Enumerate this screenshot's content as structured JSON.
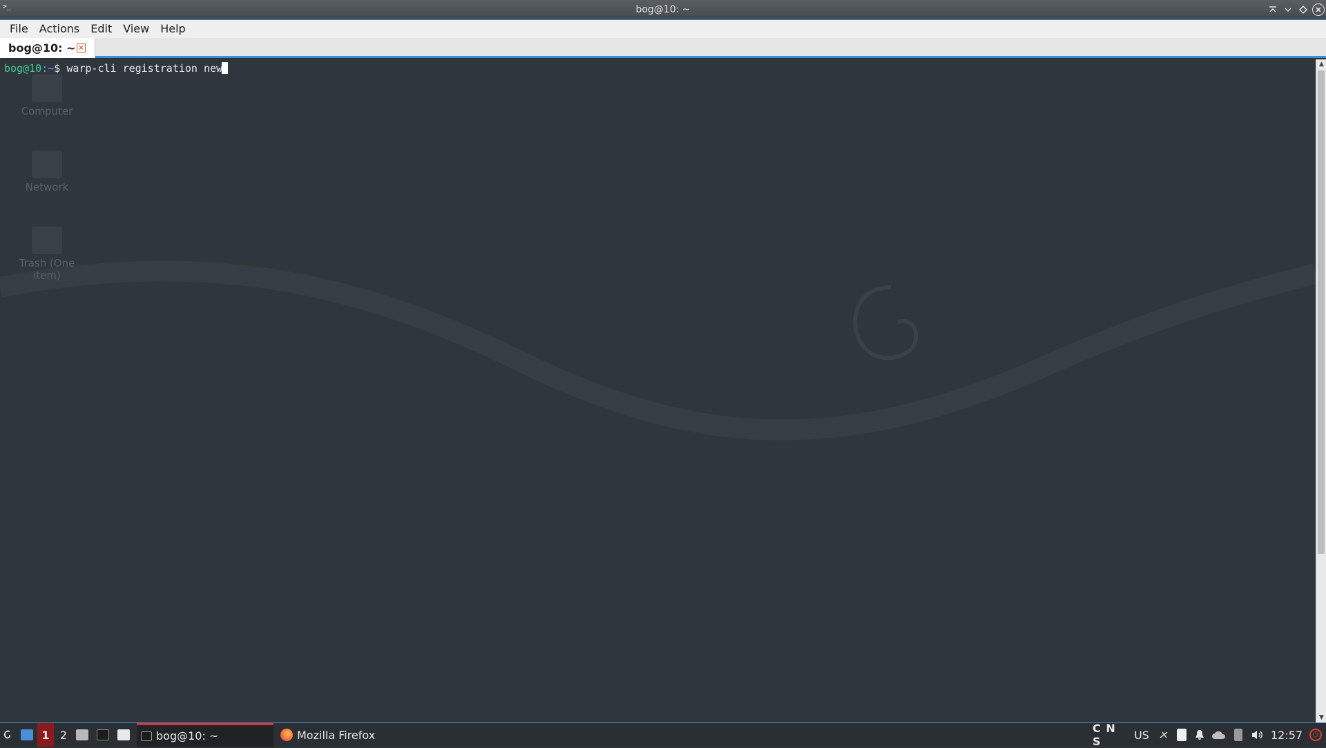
{
  "window": {
    "title": "bog@10: ~",
    "icon": "terminal-icon",
    "buttons": [
      "keep-above-icon",
      "minimize-icon",
      "maximize-icon",
      "close-icon"
    ]
  },
  "menubar": {
    "items": [
      "File",
      "Actions",
      "Edit",
      "View",
      "Help"
    ]
  },
  "tabs": [
    {
      "label": "bog@10: ~",
      "active": true
    }
  ],
  "terminal": {
    "prompt_user": "bog@10",
    "prompt_path": ":~",
    "prompt_symbol": "$ ",
    "command": "warp-cli registration new"
  },
  "desktop_icons": [
    {
      "label": "Computer",
      "icon": "computer-icon"
    },
    {
      "label": "Network",
      "icon": "network-icon"
    },
    {
      "label": "Trash (One item)",
      "icon": "trash-icon"
    }
  ],
  "taskbar": {
    "workspaces": [
      "1",
      "2"
    ],
    "active_workspace": "1",
    "tasks": [
      {
        "label": "bog@10: ~",
        "icon": "terminal-icon",
        "active": true
      },
      {
        "label": "Mozilla Firefox",
        "icon": "firefox-icon",
        "active": false
      }
    ],
    "keyboard_locks": "C N S",
    "keyboard_layout": "US",
    "clock": "12:57"
  },
  "colors": {
    "accent": "#3d8fd8",
    "prompt_user": "#3ed08b",
    "prompt_path": "#5aa5f0",
    "terminal_bg": "#30363d",
    "active_task_marker": "#d8343c",
    "workspace_active": "#8b1a1a"
  }
}
